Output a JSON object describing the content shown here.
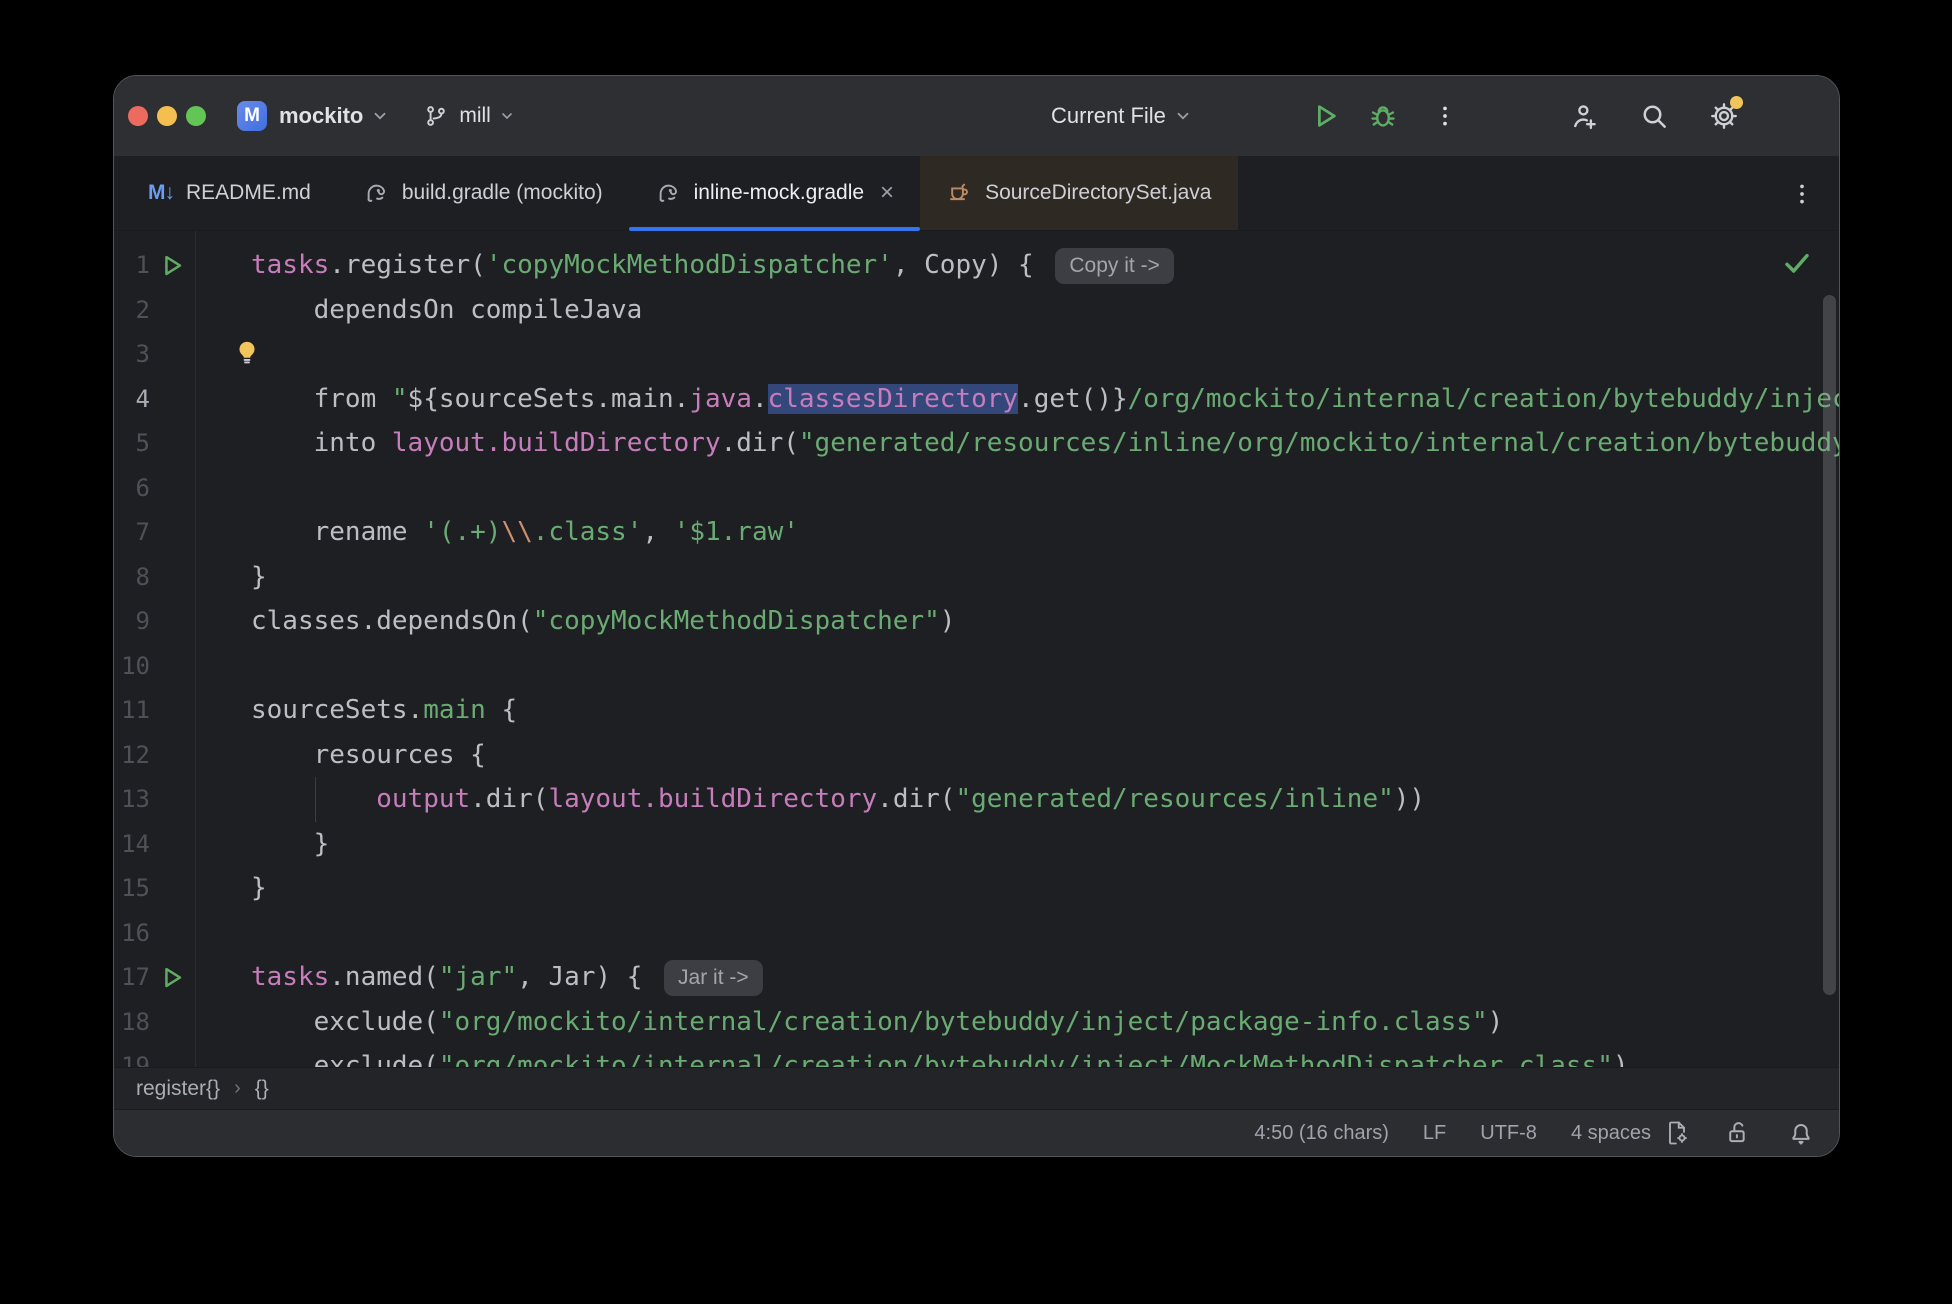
{
  "window": {
    "app": "IntelliJ IDEA"
  },
  "titlebar": {
    "project": {
      "abbrev": "M",
      "name": "mockito"
    },
    "branch": {
      "name": "mill"
    },
    "run_config": "Current File",
    "icons_left": [
      "project-icon",
      "git-branch-icon"
    ],
    "icons_right": [
      "run-icon",
      "debug-icon",
      "kebab-menu-icon",
      "add-user-icon",
      "search-icon",
      "settings-gear-icon"
    ],
    "settings_has_notification_dot": true
  },
  "tabs": [
    {
      "id": "readme",
      "label": "README.md",
      "icon": "markdown-icon",
      "state": "normal"
    },
    {
      "id": "build",
      "label": "build.gradle (mockito)",
      "icon": "gradle-icon",
      "state": "normal"
    },
    {
      "id": "inline",
      "label": "inline-mock.gradle",
      "icon": "gradle-icon",
      "state": "active",
      "closable": true
    },
    {
      "id": "sourcedir",
      "label": "SourceDirectorySet.java",
      "icon": "java-icon",
      "state": "preview"
    }
  ],
  "editor": {
    "current_line": 4,
    "selection_word": "classesDirectory",
    "inspection_status": "ok-checkmark",
    "lines": [
      {
        "n": 1,
        "run": true,
        "inlay": "Copy it ->",
        "seg": [
          {
            "t": "tasks",
            "c": "prop"
          },
          {
            "t": ".register(",
            "c": "fg"
          },
          {
            "t": "'copyMockMethodDispatcher'",
            "c": "str"
          },
          {
            "t": ", Copy) { ",
            "c": "fg"
          }
        ]
      },
      {
        "n": 2,
        "seg": [
          {
            "t": "    dependsOn compileJava",
            "c": "fg"
          }
        ]
      },
      {
        "n": 3,
        "bulb": true,
        "seg": []
      },
      {
        "n": 4,
        "current": true,
        "seg": [
          {
            "t": "    from ",
            "c": "fg"
          },
          {
            "t": "\"",
            "c": "str"
          },
          {
            "t": "${",
            "c": "fg"
          },
          {
            "t": "sourceSets.main.",
            "c": "fg"
          },
          {
            "t": "java",
            "c": "prop"
          },
          {
            "t": ".",
            "c": "fg"
          },
          {
            "t": "classesDirectory",
            "c": "prop",
            "sel": true
          },
          {
            "t": ".get()}",
            "c": "fg"
          },
          {
            "t": "/org/mockito/internal/creation/bytebuddy/inject",
            "c": "str"
          }
        ]
      },
      {
        "n": 5,
        "seg": [
          {
            "t": "    into ",
            "c": "fg"
          },
          {
            "t": "layout.buildDirectory",
            "c": "prop"
          },
          {
            "t": ".dir(",
            "c": "fg"
          },
          {
            "t": "\"generated/resources/inline/org/mockito/internal/creation/bytebuddy",
            "c": "str"
          }
        ]
      },
      {
        "n": 6,
        "seg": []
      },
      {
        "n": 7,
        "seg": [
          {
            "t": "    rename ",
            "c": "fg"
          },
          {
            "t": "'(.+)",
            "c": "str"
          },
          {
            "t": "\\\\",
            "c": "esc"
          },
          {
            "t": ".class'",
            "c": "str"
          },
          {
            "t": ", ",
            "c": "fg"
          },
          {
            "t": "'$1.raw'",
            "c": "str"
          }
        ]
      },
      {
        "n": 8,
        "seg": [
          {
            "t": "}",
            "c": "fg"
          }
        ]
      },
      {
        "n": 9,
        "seg": [
          {
            "t": "classes.dependsOn(",
            "c": "fg"
          },
          {
            "t": "\"copyMockMethodDispatcher\"",
            "c": "str"
          },
          {
            "t": ")",
            "c": "fg"
          }
        ]
      },
      {
        "n": 10,
        "seg": []
      },
      {
        "n": 11,
        "seg": [
          {
            "t": "sourceSets.",
            "c": "fg"
          },
          {
            "t": "main",
            "c": "str"
          },
          {
            "t": " {",
            "c": "fg"
          }
        ]
      },
      {
        "n": 12,
        "seg": [
          {
            "t": "    resources {",
            "c": "fg"
          }
        ]
      },
      {
        "n": 13,
        "guide": true,
        "seg": [
          {
            "t": "        ",
            "c": "fg"
          },
          {
            "t": "output",
            "c": "prop"
          },
          {
            "t": ".dir(",
            "c": "fg"
          },
          {
            "t": "layout.buildDirectory",
            "c": "prop"
          },
          {
            "t": ".dir(",
            "c": "fg"
          },
          {
            "t": "\"generated/resources/inline\"",
            "c": "str"
          },
          {
            "t": "))",
            "c": "fg"
          }
        ]
      },
      {
        "n": 14,
        "seg": [
          {
            "t": "    }",
            "c": "fg"
          }
        ]
      },
      {
        "n": 15,
        "seg": [
          {
            "t": "}",
            "c": "fg"
          }
        ]
      },
      {
        "n": 16,
        "seg": []
      },
      {
        "n": 17,
        "run": true,
        "inlay": "Jar it ->",
        "seg": [
          {
            "t": "tasks",
            "c": "prop"
          },
          {
            "t": ".named(",
            "c": "fg"
          },
          {
            "t": "\"jar\"",
            "c": "str"
          },
          {
            "t": ", Jar) { ",
            "c": "fg"
          }
        ]
      },
      {
        "n": 18,
        "seg": [
          {
            "t": "    exclude(",
            "c": "fg"
          },
          {
            "t": "\"org/mockito/internal/creation/bytebuddy/inject/package-info.class\"",
            "c": "str"
          },
          {
            "t": ")",
            "c": "fg"
          }
        ]
      },
      {
        "n": 19,
        "seg": [
          {
            "t": "    exclude(",
            "c": "fg"
          },
          {
            "t": "\"org/mockito/internal/creation/bytebuddy/inject/MockMethodDispatcher.class\"",
            "c": "str"
          },
          {
            "t": ")",
            "c": "fg"
          }
        ]
      }
    ]
  },
  "breadcrumbs": [
    "register{}",
    "{}"
  ],
  "statusbar": {
    "items": [
      {
        "type": "text",
        "label": "4:50 (16 chars)",
        "name": "caret-position"
      },
      {
        "type": "text",
        "label": "LF",
        "name": "line-separator"
      },
      {
        "type": "text",
        "label": "UTF-8",
        "name": "encoding"
      },
      {
        "type": "text",
        "label": "4 spaces",
        "name": "indent"
      },
      {
        "type": "icon",
        "icon": "code-style-config-icon",
        "name": "indent-config"
      },
      {
        "type": "icon",
        "icon": "unlocked-icon",
        "name": "readonly-toggle"
      },
      {
        "type": "icon",
        "icon": "bell-icon",
        "name": "notifications"
      }
    ]
  },
  "colors": {
    "editor_bg": "#1e1f22",
    "chrome_bg": "#2d2f33",
    "statusbar_bg": "#2b2d30",
    "accent_blue": "#3574f0",
    "string_green": "#6aab73",
    "property_pink": "#c77dbb",
    "escape_orange": "#cf8e6d",
    "plain_text": "#bcbec4",
    "run_green": "#5fad65",
    "bulb_yellow": "#f2c55c",
    "selection_blue": "#33477b",
    "current_line": "#26282e",
    "preview_tab_bg": "#2e2a23",
    "notification_dot": "#f2c55c",
    "traffic_red": "#ed6a5e",
    "traffic_yellow": "#f5bf4f",
    "traffic_green": "#62c554"
  }
}
